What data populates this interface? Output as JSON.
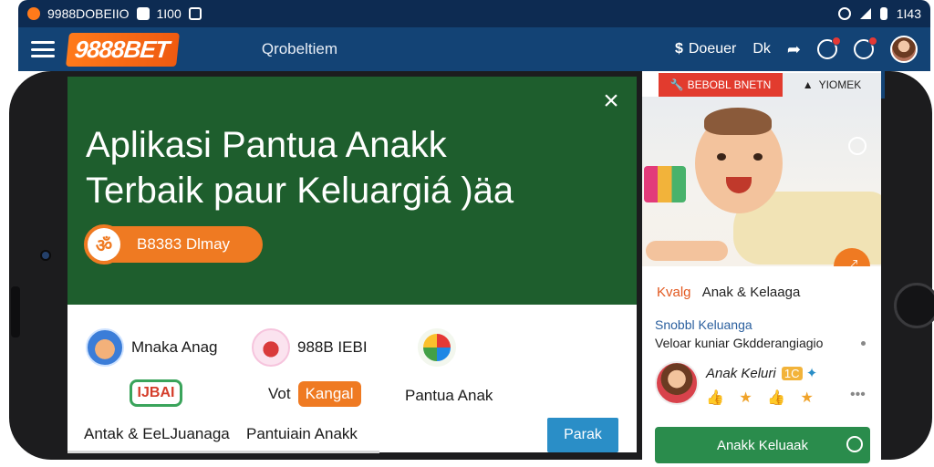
{
  "status_bar": {
    "left_text": "9988DOBEIIO",
    "center_text": "1I00",
    "time": "1I43"
  },
  "header": {
    "logo_main": "9888",
    "logo_bet": "BET",
    "title": "Qrobeltiem",
    "dollar_label": "Doeuer",
    "lang_label": "Dk"
  },
  "hero": {
    "title_line1": "Aplikasi Pantua Anakk",
    "title_line2": "Terbaik paur Keluargiá )äa",
    "close_symbol": "×",
    "cta_icon": "ॐ",
    "cta_label": "B8383 Dlmay"
  },
  "grid": {
    "item1_label": "Mnaka Anag",
    "item2_label": "988B IEBI",
    "item3_label": "Pantua Anak",
    "chip_green": "IJBAI",
    "vot_prefix": "Vot",
    "chip_orange": "Kangal",
    "item4_label": "Antak & EeLJuanaga",
    "item5_label": "Pantuiain Anakk",
    "parak_button": "Parak"
  },
  "right": {
    "tab1_label": "BEBOBL BNETN",
    "tab2_label": "YIOMEK",
    "section1_o": "Kvalg",
    "section1_text": "Anak & Kelaaga",
    "section2_title": "Snobbl Keluanga",
    "section2_sub": "Veloar kuniar Gkdderangiagio",
    "person_name": "Anak Keluri",
    "person_tag": "1C",
    "stars": "👍 ★ 👍 ★",
    "more": "•••",
    "button_label": "Anakk Keluaak"
  },
  "colors": {
    "status": "#0d2b52",
    "header": "#134375",
    "hero_green": "#1e5e2d",
    "accent_orange": "#ef7a22",
    "button_blue": "#2a8ec7",
    "button_green": "#2a8c4c",
    "tab_red": "#e23b2e"
  }
}
